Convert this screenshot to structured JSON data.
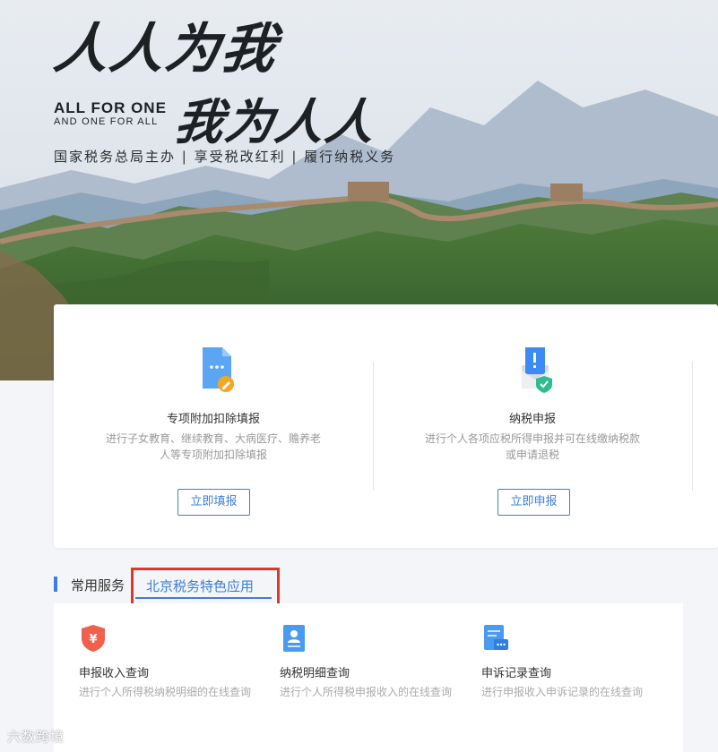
{
  "hero": {
    "slogan_line1": "人人为我",
    "slogan_line2": "我为人人",
    "english_line1": "ALL FOR ONE",
    "english_line2": "AND ONE FOR ALL",
    "tagline": "国家税务总局主办 | 享受税改红利 | 履行纳税义务"
  },
  "actions": [
    {
      "icon": "document-edit-icon",
      "title": "专项附加扣除填报",
      "desc": "进行子女教育、继续教育、大病医疗、赡养老人等专项附加扣除填报",
      "button": "立即填报"
    },
    {
      "icon": "tax-envelope-shield-icon",
      "title": "纳税申报",
      "desc": "进行个人各项应税所得申报并可在线缴纳税款或申请退税",
      "button": "立即申报"
    }
  ],
  "tabs": {
    "common": "常用服务",
    "beijing": "北京税务特色应用"
  },
  "services": [
    {
      "icon": "yuan-shield-icon",
      "title": "申报收入查询",
      "desc": "进行个人所得税纳税明细的在线查询"
    },
    {
      "icon": "person-document-icon",
      "title": "纳税明细查询",
      "desc": "进行个人所得税申报收入的在线查询"
    },
    {
      "icon": "message-document-icon",
      "title": "申诉记录查询",
      "desc": "进行申报收入申诉记录的在线查询"
    }
  ],
  "watermark": "六数跨境",
  "colors": {
    "accent": "#3d7fd9",
    "highlight_border": "#d93a2b",
    "background": "#f4f5f8"
  }
}
